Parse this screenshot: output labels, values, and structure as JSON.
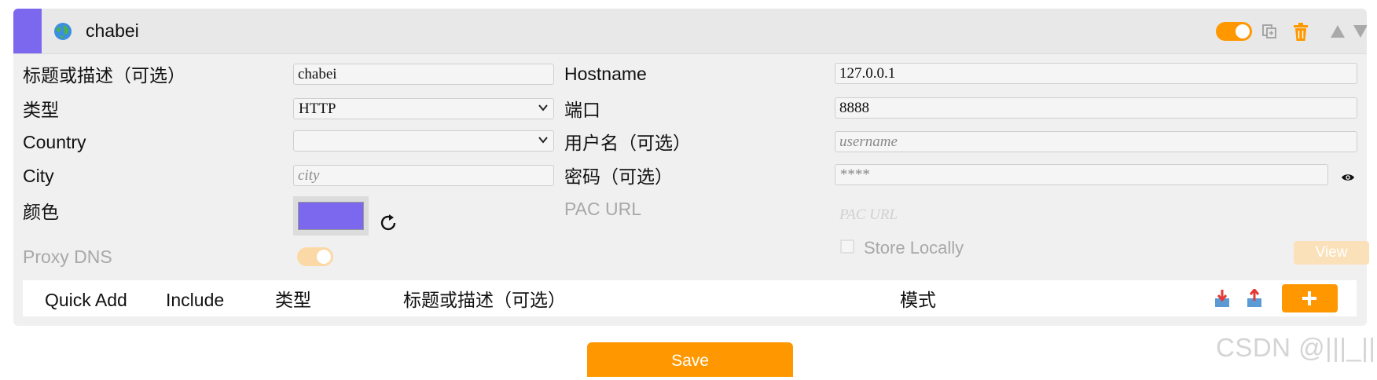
{
  "proxy": {
    "title": "chabei",
    "color": "#7b68ee",
    "enabled": true
  },
  "labels": {
    "title_desc": "标题或描述（可选）",
    "type": "类型",
    "country": "Country",
    "city": "City",
    "color": "颜色",
    "proxy_dns": "Proxy DNS",
    "hostname": "Hostname",
    "port": "端口",
    "username": "用户名（可选）",
    "password": "密码（可选）",
    "pac_url": "PAC URL",
    "store_locally": "Store Locally",
    "view": "View"
  },
  "fields": {
    "title_value": "chabei",
    "type_value": "HTTP",
    "country_value": "",
    "city_placeholder": "city",
    "hostname_value": "127.0.0.1",
    "port_value": "8888",
    "username_placeholder": "username",
    "password_placeholder": "****",
    "pac_url_placeholder": "PAC URL"
  },
  "rules_header": {
    "quick_add": "Quick Add",
    "include": "Include",
    "type": "类型",
    "title_desc": "标题或描述（可选）",
    "pattern": "模式"
  },
  "save_label": "Save",
  "watermark": "CSDN @|||_|||",
  "accent_color": "#ff9800",
  "icons": [
    "globe-icon",
    "duplicate-icon",
    "trash-icon",
    "move-up-icon",
    "move-down-icon",
    "refresh-icon",
    "eye-icon",
    "import-icon",
    "export-icon",
    "plus-icon"
  ]
}
